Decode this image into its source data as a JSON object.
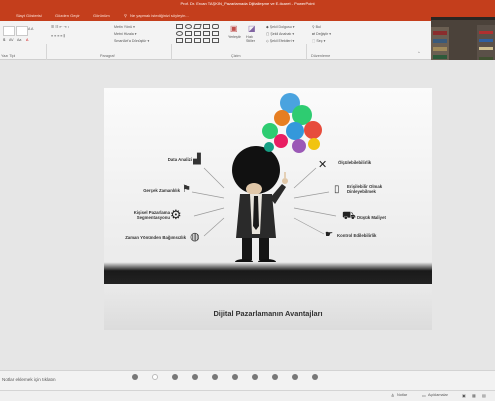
{
  "window": {
    "title": "Prof. Dr. Ercan TAŞKIN_Pazarlamada Dijitalleşme ve E-ticaret - PowerPoint"
  },
  "tabs": [
    "Slayt Gösterisi",
    "Gözden Geçir",
    "Görünüm"
  ],
  "tell_me": "Ne yapmak istediğinizi söyleyin...",
  "ribbon": {
    "paragraph_items": [
      "Metin Yönü",
      "Metni Hizala",
      "SmartArt'a Dönüştür"
    ],
    "arrange_label": "Yerleştir",
    "quick_styles_label": "Hızlı Stiller",
    "shape_items": [
      "Şekil Dolgusu",
      "Şekil Anahatı",
      "Şekil Efektleri"
    ],
    "edit_items": [
      "Bul",
      "Değiştir",
      "Seç"
    ],
    "group_slides": "Slaytlar",
    "group_paragraph": "Paragraf",
    "group_drawing": "Çizim",
    "group_editing": "Düzenleme",
    "group_font": "Yazı Tipi"
  },
  "slide": {
    "caption": "Dijital Pazarlamanın Avantajları",
    "features_left": [
      "Data Analizi",
      "Gerçek Zamanlılık",
      "Kişisel Pazarlama Segmentasyonu",
      "Zaman Yönünden Bağımsızlık"
    ],
    "features_right": [
      "Ölçülebilebilirlik",
      "Erişilebilir Olmak Dinleyebilmek",
      "Düşük Maliyet",
      "Kontrol Edilebilirlik"
    ],
    "hub_icons": [
      "search-icon",
      "email-icon",
      "sms-icon",
      "like-icon",
      "rss-icon",
      "chat-icon"
    ]
  },
  "notes": {
    "placeholder": "Notlar eklemek için tıklatın"
  },
  "status": {
    "notes_btn": "Notlar",
    "comments_btn": "Açıklamalar"
  },
  "colors": {
    "accent": "#c43e1c"
  }
}
